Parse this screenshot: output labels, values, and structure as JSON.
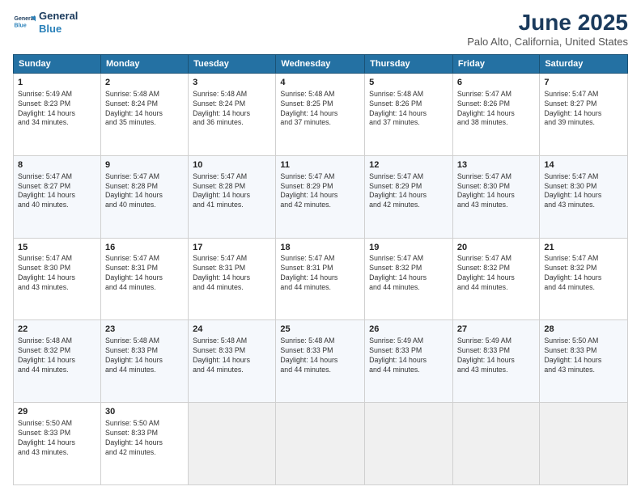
{
  "header": {
    "logo_line1": "General",
    "logo_line2": "Blue",
    "title": "June 2025",
    "subtitle": "Palo Alto, California, United States"
  },
  "columns": [
    "Sunday",
    "Monday",
    "Tuesday",
    "Wednesday",
    "Thursday",
    "Friday",
    "Saturday"
  ],
  "weeks": [
    [
      {
        "day": "1",
        "info": "Sunrise: 5:49 AM\nSunset: 8:23 PM\nDaylight: 14 hours\nand 34 minutes."
      },
      {
        "day": "2",
        "info": "Sunrise: 5:48 AM\nSunset: 8:24 PM\nDaylight: 14 hours\nand 35 minutes."
      },
      {
        "day": "3",
        "info": "Sunrise: 5:48 AM\nSunset: 8:24 PM\nDaylight: 14 hours\nand 36 minutes."
      },
      {
        "day": "4",
        "info": "Sunrise: 5:48 AM\nSunset: 8:25 PM\nDaylight: 14 hours\nand 37 minutes."
      },
      {
        "day": "5",
        "info": "Sunrise: 5:48 AM\nSunset: 8:26 PM\nDaylight: 14 hours\nand 37 minutes."
      },
      {
        "day": "6",
        "info": "Sunrise: 5:47 AM\nSunset: 8:26 PM\nDaylight: 14 hours\nand 38 minutes."
      },
      {
        "day": "7",
        "info": "Sunrise: 5:47 AM\nSunset: 8:27 PM\nDaylight: 14 hours\nand 39 minutes."
      }
    ],
    [
      {
        "day": "8",
        "info": "Sunrise: 5:47 AM\nSunset: 8:27 PM\nDaylight: 14 hours\nand 40 minutes."
      },
      {
        "day": "9",
        "info": "Sunrise: 5:47 AM\nSunset: 8:28 PM\nDaylight: 14 hours\nand 40 minutes."
      },
      {
        "day": "10",
        "info": "Sunrise: 5:47 AM\nSunset: 8:28 PM\nDaylight: 14 hours\nand 41 minutes."
      },
      {
        "day": "11",
        "info": "Sunrise: 5:47 AM\nSunset: 8:29 PM\nDaylight: 14 hours\nand 42 minutes."
      },
      {
        "day": "12",
        "info": "Sunrise: 5:47 AM\nSunset: 8:29 PM\nDaylight: 14 hours\nand 42 minutes."
      },
      {
        "day": "13",
        "info": "Sunrise: 5:47 AM\nSunset: 8:30 PM\nDaylight: 14 hours\nand 43 minutes."
      },
      {
        "day": "14",
        "info": "Sunrise: 5:47 AM\nSunset: 8:30 PM\nDaylight: 14 hours\nand 43 minutes."
      }
    ],
    [
      {
        "day": "15",
        "info": "Sunrise: 5:47 AM\nSunset: 8:30 PM\nDaylight: 14 hours\nand 43 minutes."
      },
      {
        "day": "16",
        "info": "Sunrise: 5:47 AM\nSunset: 8:31 PM\nDaylight: 14 hours\nand 44 minutes."
      },
      {
        "day": "17",
        "info": "Sunrise: 5:47 AM\nSunset: 8:31 PM\nDaylight: 14 hours\nand 44 minutes."
      },
      {
        "day": "18",
        "info": "Sunrise: 5:47 AM\nSunset: 8:31 PM\nDaylight: 14 hours\nand 44 minutes."
      },
      {
        "day": "19",
        "info": "Sunrise: 5:47 AM\nSunset: 8:32 PM\nDaylight: 14 hours\nand 44 minutes."
      },
      {
        "day": "20",
        "info": "Sunrise: 5:47 AM\nSunset: 8:32 PM\nDaylight: 14 hours\nand 44 minutes."
      },
      {
        "day": "21",
        "info": "Sunrise: 5:47 AM\nSunset: 8:32 PM\nDaylight: 14 hours\nand 44 minutes."
      }
    ],
    [
      {
        "day": "22",
        "info": "Sunrise: 5:48 AM\nSunset: 8:32 PM\nDaylight: 14 hours\nand 44 minutes."
      },
      {
        "day": "23",
        "info": "Sunrise: 5:48 AM\nSunset: 8:33 PM\nDaylight: 14 hours\nand 44 minutes."
      },
      {
        "day": "24",
        "info": "Sunrise: 5:48 AM\nSunset: 8:33 PM\nDaylight: 14 hours\nand 44 minutes."
      },
      {
        "day": "25",
        "info": "Sunrise: 5:48 AM\nSunset: 8:33 PM\nDaylight: 14 hours\nand 44 minutes."
      },
      {
        "day": "26",
        "info": "Sunrise: 5:49 AM\nSunset: 8:33 PM\nDaylight: 14 hours\nand 44 minutes."
      },
      {
        "day": "27",
        "info": "Sunrise: 5:49 AM\nSunset: 8:33 PM\nDaylight: 14 hours\nand 43 minutes."
      },
      {
        "day": "28",
        "info": "Sunrise: 5:50 AM\nSunset: 8:33 PM\nDaylight: 14 hours\nand 43 minutes."
      }
    ],
    [
      {
        "day": "29",
        "info": "Sunrise: 5:50 AM\nSunset: 8:33 PM\nDaylight: 14 hours\nand 43 minutes."
      },
      {
        "day": "30",
        "info": "Sunrise: 5:50 AM\nSunset: 8:33 PM\nDaylight: 14 hours\nand 42 minutes."
      },
      {
        "day": "",
        "info": ""
      },
      {
        "day": "",
        "info": ""
      },
      {
        "day": "",
        "info": ""
      },
      {
        "day": "",
        "info": ""
      },
      {
        "day": "",
        "info": ""
      }
    ]
  ]
}
